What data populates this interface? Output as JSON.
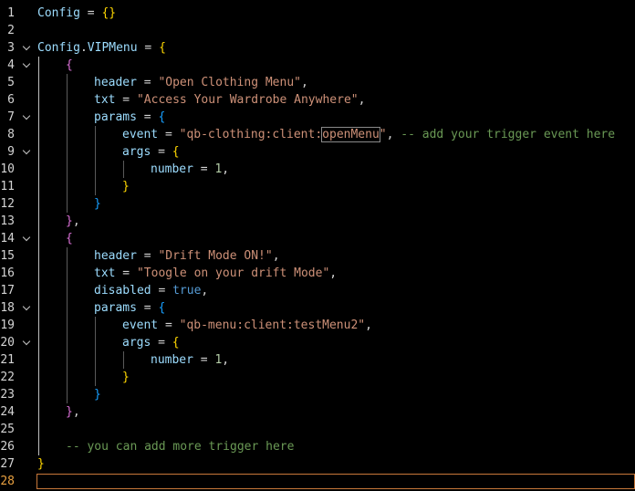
{
  "editor": {
    "language": "lua",
    "active_line": 28,
    "colors": {
      "background": "#000000",
      "identifier": "#9cdcfe",
      "string": "#ce9178",
      "number": "#b5cea8",
      "boolean": "#569cd6",
      "comment": "#6a9955",
      "bracket_level1": "#ffd700",
      "bracket_level2": "#da70d6",
      "bracket_level3": "#179fff",
      "current_line_border": "#c8783a"
    },
    "lines": [
      {
        "n": "1",
        "fold": false,
        "indent": 0,
        "tokens": [
          [
            "Config",
            "t-ident"
          ],
          [
            " = ",
            "t-op"
          ],
          [
            "{}",
            "b1"
          ]
        ]
      },
      {
        "n": "2",
        "fold": false,
        "indent": 0,
        "tokens": []
      },
      {
        "n": "3",
        "fold": true,
        "indent": 0,
        "tokens": [
          [
            "Config",
            "t-ident"
          ],
          [
            ".",
            "t-op"
          ],
          [
            "VIPMenu",
            "t-ident"
          ],
          [
            " = ",
            "t-op"
          ],
          [
            "{",
            "b1"
          ]
        ]
      },
      {
        "n": "4",
        "fold": true,
        "indent": 1,
        "tokens": [
          [
            "{",
            "b2"
          ]
        ]
      },
      {
        "n": "5",
        "fold": false,
        "indent": 2,
        "tokens": [
          [
            "header",
            "t-key"
          ],
          [
            " = ",
            "t-op"
          ],
          [
            "\"Open Clothing Menu\"",
            "t-str"
          ],
          [
            ",",
            "t-op"
          ]
        ]
      },
      {
        "n": "6",
        "fold": false,
        "indent": 2,
        "tokens": [
          [
            "txt",
            "t-key"
          ],
          [
            " = ",
            "t-op"
          ],
          [
            "\"Access Your Wardrobe Anywhere\"",
            "t-str"
          ],
          [
            ",",
            "t-op"
          ]
        ]
      },
      {
        "n": "7",
        "fold": true,
        "indent": 2,
        "tokens": [
          [
            "params",
            "t-key"
          ],
          [
            " = ",
            "t-op"
          ],
          [
            "{",
            "b3"
          ]
        ]
      },
      {
        "n": "8",
        "fold": false,
        "indent": 3,
        "tokens": [
          [
            "event",
            "t-key"
          ],
          [
            " = ",
            "t-op"
          ],
          [
            "\"qb-clothing:client:",
            "t-str"
          ],
          [
            "openMenu",
            "t-str match"
          ],
          [
            "\"",
            "t-str"
          ],
          [
            ", ",
            "t-op"
          ],
          [
            "-- add your trigger event here",
            "t-com"
          ]
        ]
      },
      {
        "n": "9",
        "fold": true,
        "indent": 3,
        "tokens": [
          [
            "args",
            "t-key"
          ],
          [
            " = ",
            "t-op"
          ],
          [
            "{",
            "b1"
          ]
        ]
      },
      {
        "n": "10",
        "fold": false,
        "indent": 4,
        "tokens": [
          [
            "number",
            "t-key"
          ],
          [
            " = ",
            "t-op"
          ],
          [
            "1",
            "t-num"
          ],
          [
            ",",
            "t-op"
          ]
        ]
      },
      {
        "n": "11",
        "fold": false,
        "indent": 3,
        "tokens": [
          [
            "}",
            "b1"
          ]
        ]
      },
      {
        "n": "12",
        "fold": false,
        "indent": 2,
        "tokens": [
          [
            "}",
            "b3"
          ]
        ]
      },
      {
        "n": "13",
        "fold": false,
        "indent": 1,
        "tokens": [
          [
            "}",
            "b2"
          ],
          [
            ",",
            "t-op"
          ]
        ]
      },
      {
        "n": "14",
        "fold": true,
        "indent": 1,
        "tokens": [
          [
            "{",
            "b2"
          ]
        ]
      },
      {
        "n": "15",
        "fold": false,
        "indent": 2,
        "tokens": [
          [
            "header",
            "t-key"
          ],
          [
            " = ",
            "t-op"
          ],
          [
            "\"Drift Mode ON!\"",
            "t-str"
          ],
          [
            ",",
            "t-op"
          ]
        ]
      },
      {
        "n": "16",
        "fold": false,
        "indent": 2,
        "tokens": [
          [
            "txt",
            "t-key"
          ],
          [
            " = ",
            "t-op"
          ],
          [
            "\"Toogle on your drift Mode\"",
            "t-str"
          ],
          [
            ",",
            "t-op"
          ]
        ]
      },
      {
        "n": "17",
        "fold": false,
        "indent": 2,
        "tokens": [
          [
            "disabled",
            "t-key"
          ],
          [
            " = ",
            "t-op"
          ],
          [
            "true",
            "t-bool"
          ],
          [
            ",",
            "t-op"
          ]
        ]
      },
      {
        "n": "18",
        "fold": true,
        "indent": 2,
        "tokens": [
          [
            "params",
            "t-key"
          ],
          [
            " = ",
            "t-op"
          ],
          [
            "{",
            "b3"
          ]
        ]
      },
      {
        "n": "19",
        "fold": false,
        "indent": 3,
        "tokens": [
          [
            "event",
            "t-key"
          ],
          [
            " = ",
            "t-op"
          ],
          [
            "\"qb-menu:client:testMenu2\"",
            "t-str"
          ],
          [
            ",",
            "t-op"
          ]
        ]
      },
      {
        "n": "20",
        "fold": true,
        "indent": 3,
        "tokens": [
          [
            "args",
            "t-key"
          ],
          [
            " = ",
            "t-op"
          ],
          [
            "{",
            "b1"
          ]
        ]
      },
      {
        "n": "21",
        "fold": false,
        "indent": 4,
        "tokens": [
          [
            "number",
            "t-key"
          ],
          [
            " = ",
            "t-op"
          ],
          [
            "1",
            "t-num"
          ],
          [
            ",",
            "t-op"
          ]
        ]
      },
      {
        "n": "22",
        "fold": false,
        "indent": 3,
        "tokens": [
          [
            "}",
            "b1"
          ]
        ]
      },
      {
        "n": "23",
        "fold": false,
        "indent": 2,
        "tokens": [
          [
            "}",
            "b3"
          ]
        ]
      },
      {
        "n": "24",
        "fold": false,
        "indent": 1,
        "tokens": [
          [
            "}",
            "b2"
          ],
          [
            ",",
            "t-op"
          ]
        ]
      },
      {
        "n": "25",
        "fold": false,
        "indent": 0,
        "tokens": []
      },
      {
        "n": "26",
        "fold": false,
        "indent": 1,
        "tokens": [
          [
            "-- you can add more trigger here",
            "t-com"
          ]
        ]
      },
      {
        "n": "27",
        "fold": false,
        "indent": 0,
        "tokens": [
          [
            "}",
            "b1"
          ]
        ]
      },
      {
        "n": "28",
        "fold": false,
        "indent": 0,
        "tokens": []
      }
    ]
  }
}
